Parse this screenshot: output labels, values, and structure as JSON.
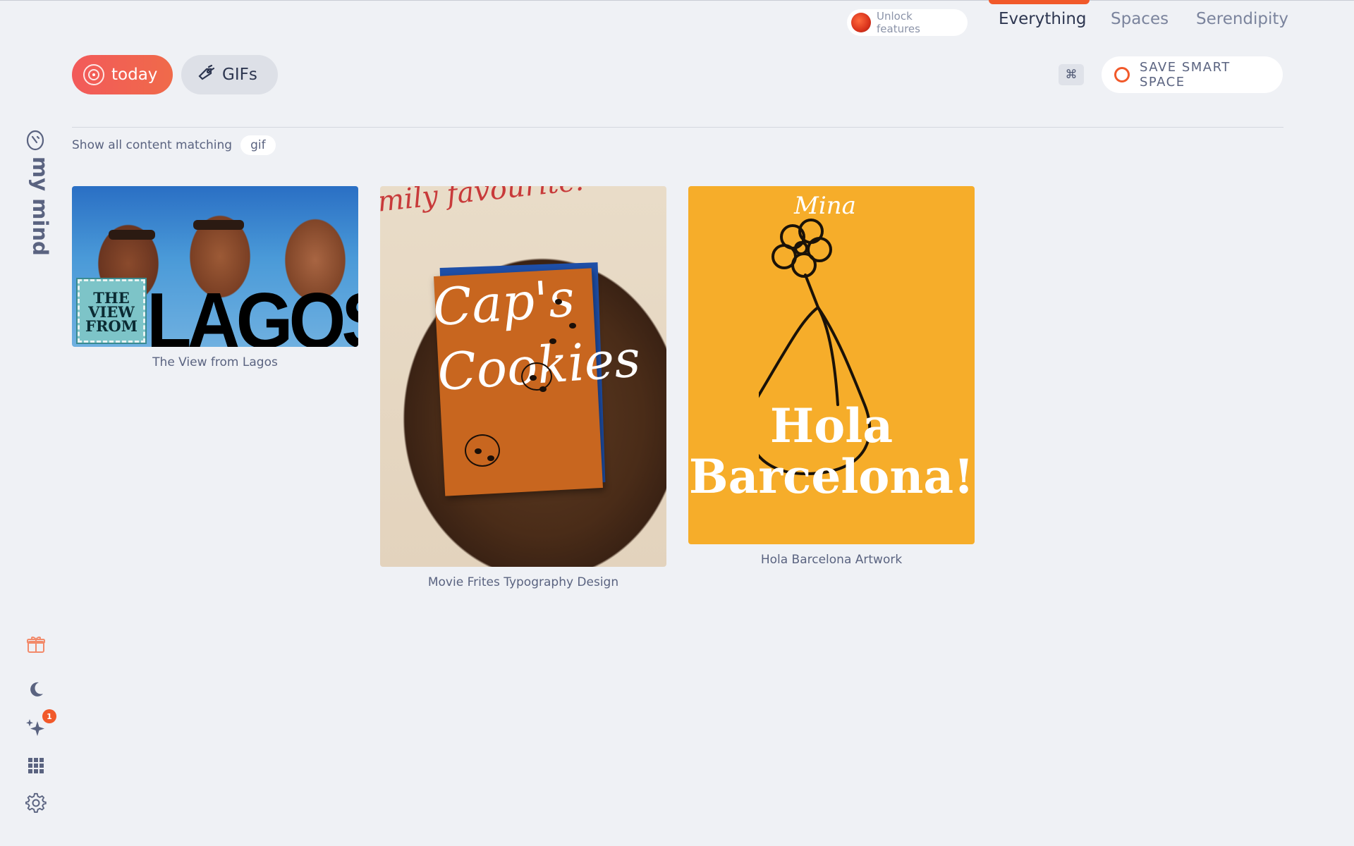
{
  "top_nav": {
    "unlock_label": "Unlock features",
    "tabs": [
      {
        "label": "Everything",
        "active": true
      },
      {
        "label": "Spaces",
        "active": false
      },
      {
        "label": "Serendipity",
        "active": false
      }
    ]
  },
  "chips": {
    "today_label": "today",
    "gifs_label": "GIFs"
  },
  "toolbar": {
    "cmd_label": "⌘",
    "save_label": "SAVE SMART SPACE"
  },
  "filter": {
    "prefix": "Show all content matching",
    "tag": "gif"
  },
  "sidebar": {
    "brand": "my mind",
    "icons": [
      "gift-icon",
      "moon-icon",
      "sparkles-icon",
      "grid-icon",
      "gear-icon"
    ],
    "sparkles_badge": "1"
  },
  "cards": [
    {
      "caption": "The View from Lagos",
      "image_text": {
        "stamp": "THE VIEW FROM",
        "big": "LAGOS"
      }
    },
    {
      "caption": "Movie Frites Typography Design",
      "image_text": {
        "script": "mily favourite!",
        "line1": "Cap's",
        "line2": "Cookies"
      }
    },
    {
      "caption": "Hola Barcelona Artwork",
      "image_text": {
        "signature": "Mina",
        "line1": "Hola",
        "line2": "Barcelona!"
      }
    }
  ],
  "colors": {
    "accent": "#f1592a",
    "background": "#eff1f5",
    "text": "#5a6380"
  }
}
